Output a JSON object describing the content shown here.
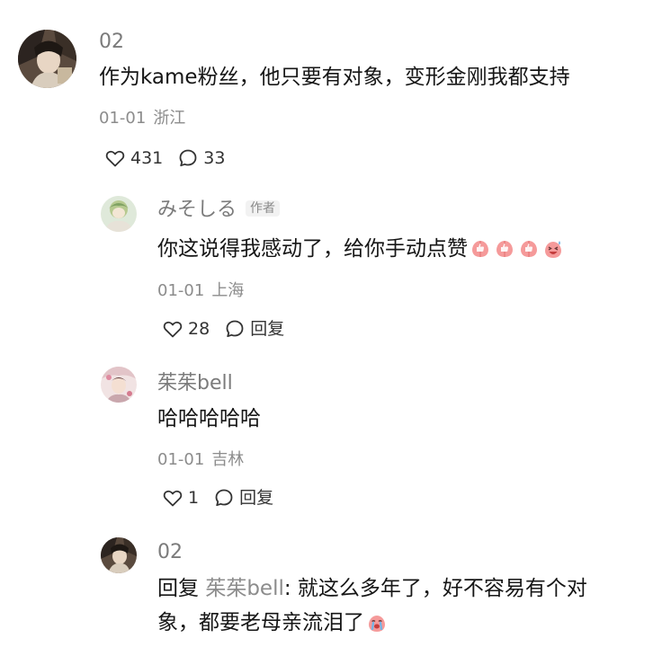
{
  "comments": [
    {
      "user": "02",
      "text": "作为kame粉丝，他只要有对象，变形金刚我都支持",
      "date": "01-01",
      "location": "浙江",
      "likes": "431",
      "replies": "33"
    },
    {
      "user": "みそしる",
      "author_tag": "作者",
      "text": "你这说得我感动了，给你手动点赞",
      "date": "01-01",
      "location": "上海",
      "likes": "28",
      "reply_label": "回复"
    },
    {
      "user": "茱茱bell",
      "text": "哈哈哈哈哈",
      "date": "01-01",
      "location": "吉林",
      "likes": "1",
      "reply_label": "回复"
    },
    {
      "user": "02",
      "reply_prefix": "回复",
      "reply_to": "茱茱bell",
      "text_line1": ": 就这么多年了，好不容易有个对",
      "text_line2": "象，都要老母亲流泪了"
    }
  ],
  "icons": {
    "like": "heart-outline-icon",
    "comment": "speech-bubble-icon",
    "emoji_thumbs": "peach-thumbs-up-emoji",
    "emoji_laugh": "laughing-emoji",
    "emoji_cry": "crying-emoji"
  }
}
